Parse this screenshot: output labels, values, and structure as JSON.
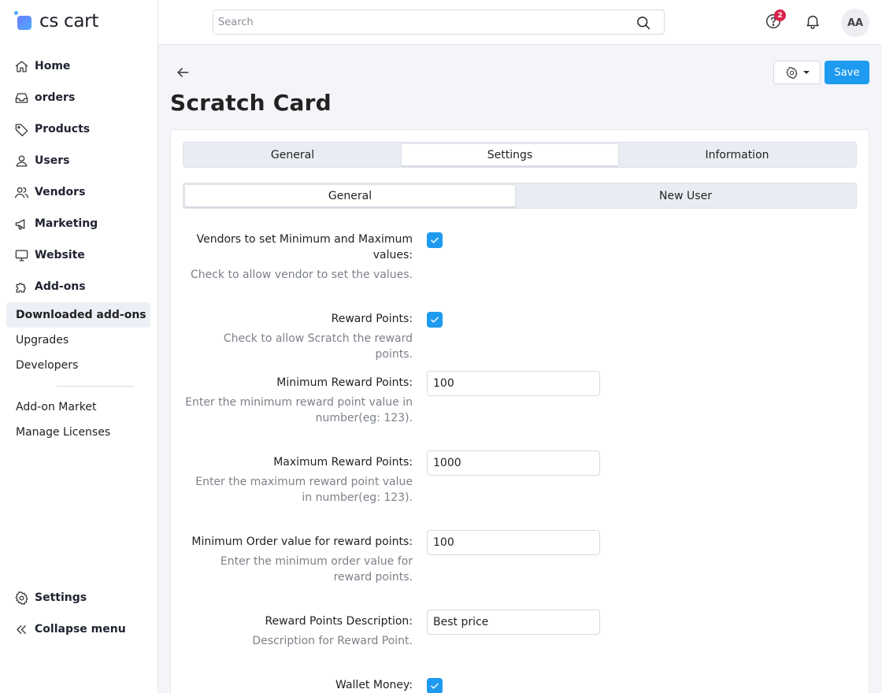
{
  "app": {
    "logo_text": "cs cart"
  },
  "sidebar": {
    "items": [
      {
        "label": "Home",
        "icon": "home-icon"
      },
      {
        "label": "orders",
        "icon": "inbox-icon"
      },
      {
        "label": "Products",
        "icon": "tag-icon"
      },
      {
        "label": "Users",
        "icon": "user-icon"
      },
      {
        "label": "Vendors",
        "icon": "users-icon"
      },
      {
        "label": "Marketing",
        "icon": "megaphone-icon"
      },
      {
        "label": "Website",
        "icon": "monitor-icon"
      },
      {
        "label": "Add-ons",
        "icon": "puzzle-icon"
      }
    ],
    "addons_sub": [
      "Downloaded add-ons",
      "Upgrades",
      "Developers"
    ],
    "addons_sub_active": "Downloaded add-ons",
    "addons_more": [
      "Add-on Market",
      "Manage Licenses"
    ],
    "bottom": [
      {
        "label": "Settings",
        "icon": "gear-icon"
      },
      {
        "label": "Collapse menu",
        "icon": "double-chevron-left-icon"
      }
    ]
  },
  "topbar": {
    "search_placeholder": "Search",
    "help_badge": "2",
    "avatar_initials": "AA"
  },
  "header": {
    "title": "Scratch Card",
    "save_label": "Save"
  },
  "tabs": {
    "main": [
      "General",
      "Settings",
      "Information"
    ],
    "main_active": "Settings",
    "sub": [
      "General",
      "New User"
    ],
    "sub_active": "General"
  },
  "settings": {
    "vendors_minmax": {
      "label": "Vendors to set Minimum and Maximum values:",
      "hint": "Check to allow vendor to set the values.",
      "checked": true
    },
    "reward_points": {
      "label": "Reward Points:",
      "hint": "Check to allow Scratch the reward points.",
      "checked": true
    },
    "min_reward_points": {
      "label": "Minimum Reward Points:",
      "hint": "Enter the minimum reward point value in number(eg: 123).",
      "value": "100"
    },
    "max_reward_points": {
      "label": "Maximum Reward Points:",
      "hint": "Enter the maximum reward point value in number(eg: 123).",
      "value": "1000"
    },
    "min_order_value": {
      "label": "Minimum Order value for reward points:",
      "hint": "Enter the minimum order value for reward points.",
      "value": "100"
    },
    "reward_description": {
      "label": "Reward Points Description:",
      "hint": "Description for Reward Point.",
      "value": "Best price"
    },
    "wallet_money": {
      "label": "Wallet Money:",
      "checked": true
    }
  },
  "colors": {
    "accent": "#1e9bf0",
    "badge": "#d8234a",
    "active_bg": "#eceff5"
  }
}
